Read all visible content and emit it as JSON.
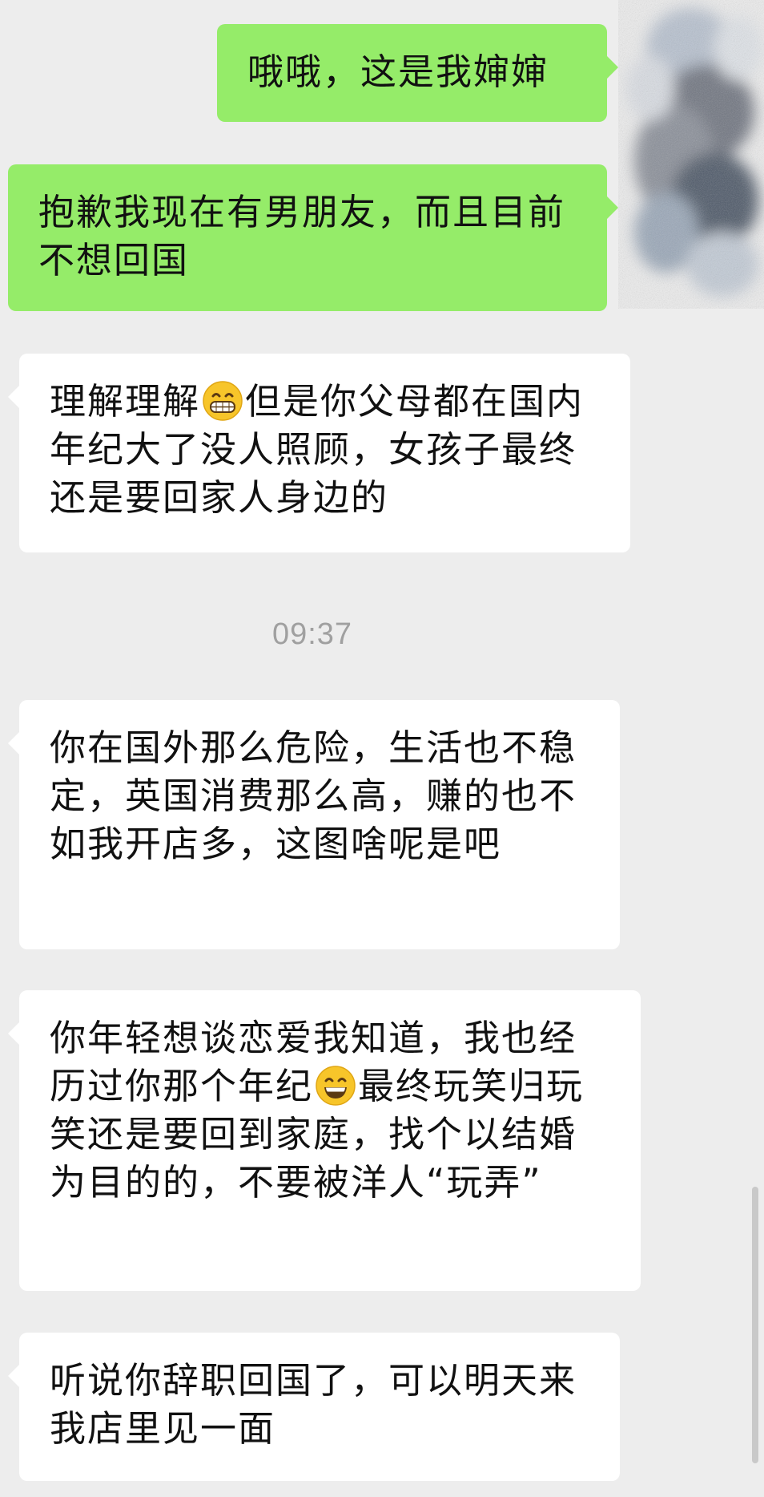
{
  "messages": [
    {
      "side": "self",
      "text": "哦哦，这是我婶婶"
    },
    {
      "side": "self",
      "text": "抱歉我现在有男朋友，而且目前不想回国"
    },
    {
      "side": "other",
      "text_before": "理解理解",
      "emoji": "grinning-face-emoji",
      "text_after": "但是你父母都在国内年纪大了没人照顾，女孩子最终还是要回家人身边的"
    },
    {
      "side": "other",
      "text": "你在国外那么危险，生活也不稳定，英国消费那么高，赚的也不如我开店多，这图啥呢是吧"
    },
    {
      "side": "other",
      "text_before": "你年轻想谈恋爱我知道，我也经历过你那个年纪",
      "emoji": "smiling-face-emoji",
      "text_after": "最终玩笑归玩笑还是要回到家庭，找个以结婚为目的的，不要被洋人“玩弄”"
    },
    {
      "side": "other",
      "text": "听说你辞职回国了，可以明天来我店里见一面"
    }
  ],
  "timestamp": "09:37",
  "colors": {
    "background": "#ededed",
    "self_bubble": "#95ec69",
    "other_bubble": "#ffffff",
    "timestamp_text": "#a0a0a0"
  },
  "avatar": {
    "icon": "blurred-avatar"
  }
}
